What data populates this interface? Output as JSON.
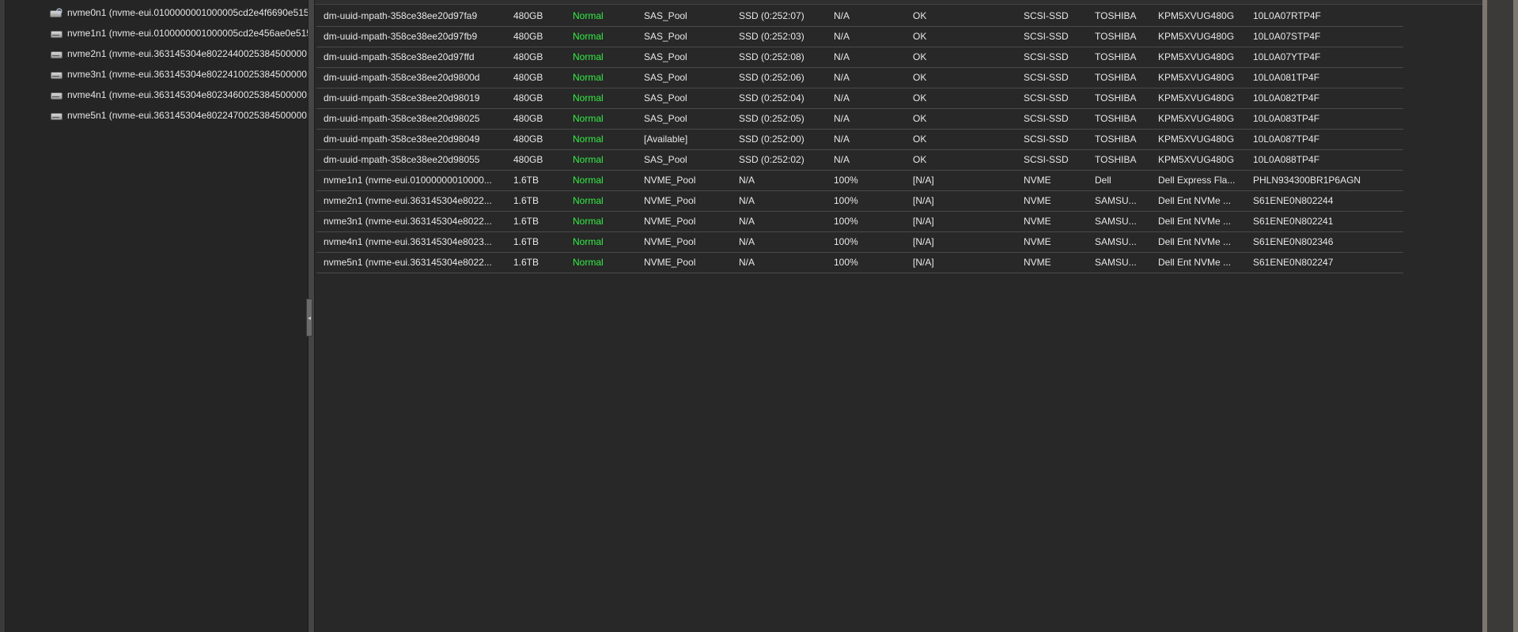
{
  "sidebar": {
    "items": [
      {
        "label": "nvme0n1 (nvme-eui.0100000001000005cd2e4f6690e515",
        "icon": "disk-gear-icon"
      },
      {
        "label": "nvme1n1 (nvme-eui.0100000001000005cd2e456ae0e515",
        "icon": "disk-icon"
      },
      {
        "label": "nvme2n1 (nvme-eui.363145304e8022440025384500000",
        "icon": "disk-icon"
      },
      {
        "label": "nvme3n1 (nvme-eui.363145304e8022410025384500000",
        "icon": "disk-icon"
      },
      {
        "label": "nvme4n1 (nvme-eui.363145304e8023460025384500000",
        "icon": "disk-icon"
      },
      {
        "label": "nvme5n1 (nvme-eui.363145304e8022470025384500000",
        "icon": "disk-icon"
      }
    ]
  },
  "splitter": {
    "handle_glyph": "◂"
  },
  "table": {
    "rows": [
      [
        "dm-uuid-mpath-358ce38ee20d97fa9",
        "480GB",
        "Normal",
        "SAS_Pool",
        "SSD (0:252:07)",
        "N/A",
        "OK",
        "SCSI-SSD",
        "TOSHIBA",
        "KPM5XVUG480G",
        "10L0A07RTP4F"
      ],
      [
        "dm-uuid-mpath-358ce38ee20d97fb9",
        "480GB",
        "Normal",
        "SAS_Pool",
        "SSD (0:252:03)",
        "N/A",
        "OK",
        "SCSI-SSD",
        "TOSHIBA",
        "KPM5XVUG480G",
        "10L0A07STP4F"
      ],
      [
        "dm-uuid-mpath-358ce38ee20d97ffd",
        "480GB",
        "Normal",
        "SAS_Pool",
        "SSD (0:252:08)",
        "N/A",
        "OK",
        "SCSI-SSD",
        "TOSHIBA",
        "KPM5XVUG480G",
        "10L0A07YTP4F"
      ],
      [
        "dm-uuid-mpath-358ce38ee20d9800d",
        "480GB",
        "Normal",
        "SAS_Pool",
        "SSD (0:252:06)",
        "N/A",
        "OK",
        "SCSI-SSD",
        "TOSHIBA",
        "KPM5XVUG480G",
        "10L0A081TP4F"
      ],
      [
        "dm-uuid-mpath-358ce38ee20d98019",
        "480GB",
        "Normal",
        "SAS_Pool",
        "SSD (0:252:04)",
        "N/A",
        "OK",
        "SCSI-SSD",
        "TOSHIBA",
        "KPM5XVUG480G",
        "10L0A082TP4F"
      ],
      [
        "dm-uuid-mpath-358ce38ee20d98025",
        "480GB",
        "Normal",
        "SAS_Pool",
        "SSD (0:252:05)",
        "N/A",
        "OK",
        "SCSI-SSD",
        "TOSHIBA",
        "KPM5XVUG480G",
        "10L0A083TP4F"
      ],
      [
        "dm-uuid-mpath-358ce38ee20d98049",
        "480GB",
        "Normal",
        "[Available]",
        "SSD (0:252:00)",
        "N/A",
        "OK",
        "SCSI-SSD",
        "TOSHIBA",
        "KPM5XVUG480G",
        "10L0A087TP4F"
      ],
      [
        "dm-uuid-mpath-358ce38ee20d98055",
        "480GB",
        "Normal",
        "SAS_Pool",
        "SSD (0:252:02)",
        "N/A",
        "OK",
        "SCSI-SSD",
        "TOSHIBA",
        "KPM5XVUG480G",
        "10L0A088TP4F"
      ],
      [
        "nvme1n1 (nvme-eui.01000000010000...",
        "1.6TB",
        "Normal",
        "NVME_Pool",
        "N/A",
        "100%",
        "[N/A]",
        "NVME",
        "Dell",
        "Dell Express Fla...",
        "PHLN934300BR1P6AGN"
      ],
      [
        "nvme2n1 (nvme-eui.363145304e8022...",
        "1.6TB",
        "Normal",
        "NVME_Pool",
        "N/A",
        "100%",
        "[N/A]",
        "NVME",
        "SAMSU...",
        "Dell Ent NVMe ...",
        "S61ENE0N802244"
      ],
      [
        "nvme3n1 (nvme-eui.363145304e8022...",
        "1.6TB",
        "Normal",
        "NVME_Pool",
        "N/A",
        "100%",
        "[N/A]",
        "NVME",
        "SAMSU...",
        "Dell Ent NVMe ...",
        "S61ENE0N802241"
      ],
      [
        "nvme4n1 (nvme-eui.363145304e8023...",
        "1.6TB",
        "Normal",
        "NVME_Pool",
        "N/A",
        "100%",
        "[N/A]",
        "NVME",
        "SAMSU...",
        "Dell Ent NVMe ...",
        "S61ENE0N802346"
      ],
      [
        "nvme5n1 (nvme-eui.363145304e8022...",
        "1.6TB",
        "Normal",
        "NVME_Pool",
        "N/A",
        "100%",
        "[N/A]",
        "NVME",
        "SAMSU...",
        "Dell Ent NVMe ...",
        "S61ENE0N802247"
      ]
    ]
  },
  "colors": {
    "status_ok": "#33ee44",
    "background": "#282828"
  }
}
